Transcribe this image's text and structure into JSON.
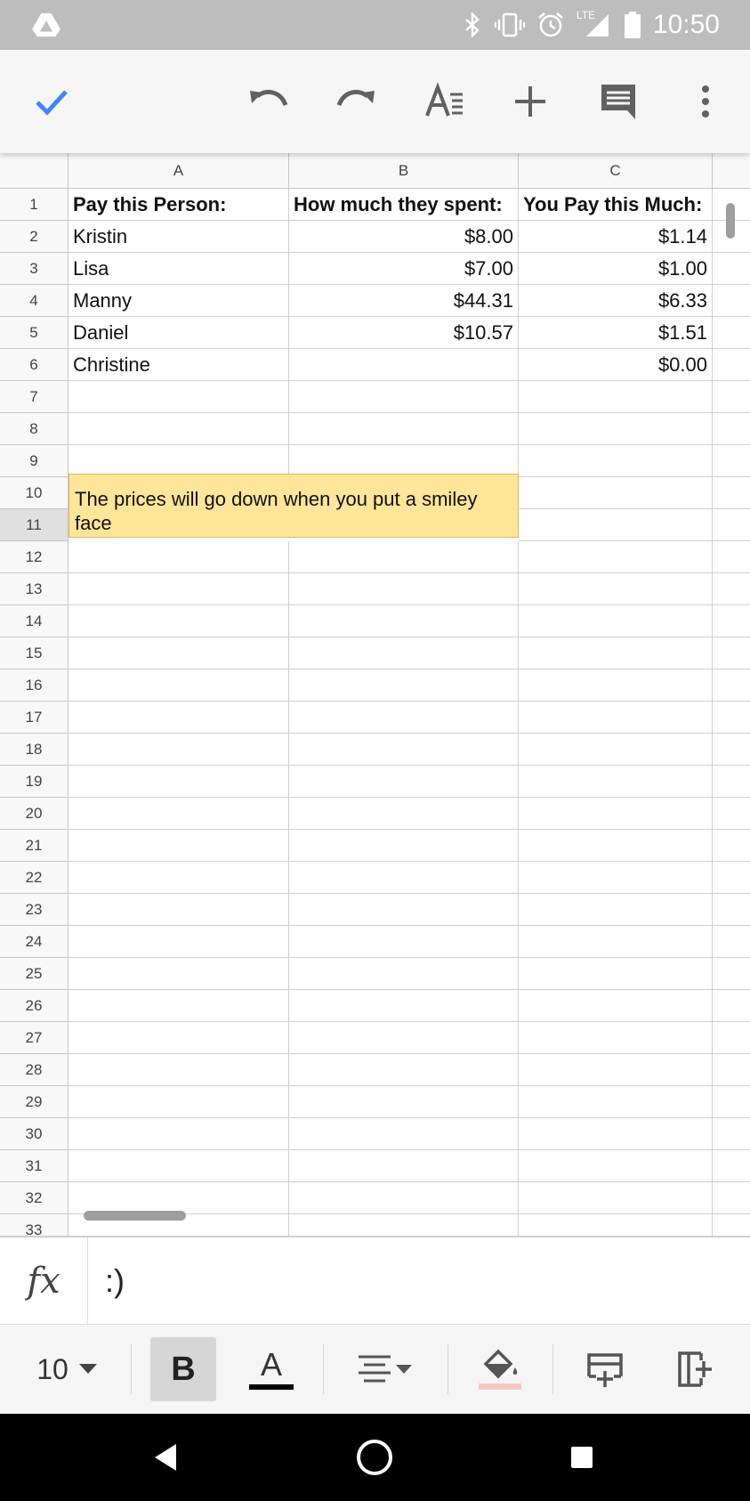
{
  "status_bar": {
    "time": "10:50",
    "network_label": "LTE",
    "icons": [
      "drive-icon",
      "bluetooth-icon",
      "vibrate-icon",
      "alarm-icon",
      "signal-icon",
      "battery-icon"
    ]
  },
  "toolbar": {
    "icons": [
      "check-icon",
      "undo-icon",
      "redo-icon",
      "text-format-icon",
      "add-icon",
      "comment-icon",
      "more-vert-icon"
    ],
    "accent_color": "#4285f4"
  },
  "sheet": {
    "columns": [
      "A",
      "B",
      "C"
    ],
    "rows": [
      "1",
      "2",
      "3",
      "4",
      "5",
      "6",
      "7",
      "8",
      "9",
      "10",
      "11",
      "12",
      "13",
      "14",
      "15",
      "16",
      "17",
      "18",
      "19",
      "20",
      "21",
      "22",
      "23",
      "24",
      "25",
      "26",
      "27",
      "28",
      "29",
      "30",
      "31",
      "32",
      "33"
    ],
    "header_row": [
      "Pay this Person:",
      "How much they spent:",
      "You Pay this Much:"
    ],
    "data": [
      [
        "Kristin",
        "$8.00",
        "$1.14"
      ],
      [
        "Lisa",
        "$7.00",
        "$1.00"
      ],
      [
        "Manny",
        "$44.31",
        "$6.33"
      ],
      [
        "Daniel",
        "$10.57",
        "$1.51"
      ],
      [
        "Christine",
        "",
        "$0.00"
      ]
    ],
    "merged_note": "The prices will go down when you put a smiley face",
    "merged_fill": "#ffe599"
  },
  "formula_bar": {
    "fx_label": "fx",
    "value": ":)"
  },
  "format_bar": {
    "font_size": "10",
    "bold_label": "B",
    "text_color_label": "A",
    "icons": [
      "font-size-dropdown-icon",
      "bold-icon",
      "text-color-icon",
      "align-icon",
      "fill-color-icon",
      "insert-row-icon",
      "insert-column-icon"
    ]
  },
  "nav_bar": {
    "icons": [
      "back-icon",
      "home-icon",
      "recents-icon"
    ]
  }
}
